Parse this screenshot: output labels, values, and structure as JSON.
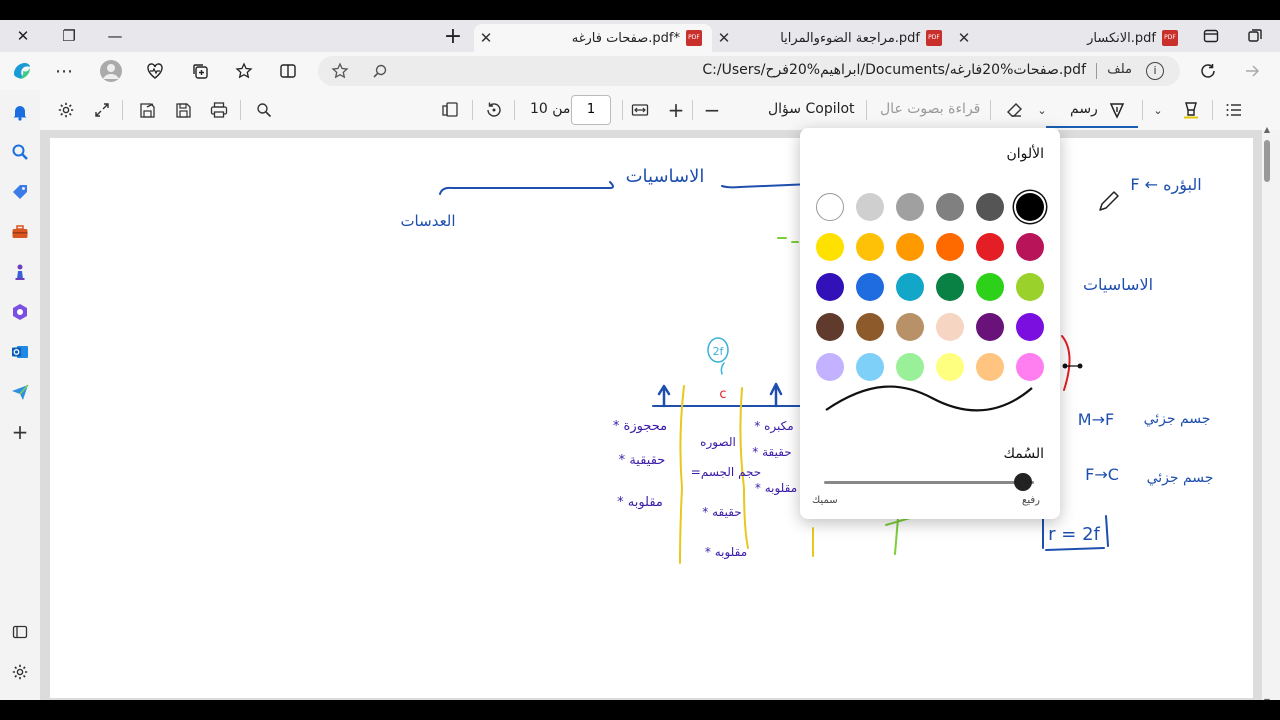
{
  "tabs": [
    {
      "title": "صفحات فارغه.pdf*",
      "active": true
    },
    {
      "title": "مراجعة الضوءوالمرايا.pdf",
      "active": false
    },
    {
      "title": "الانكسار.pdf",
      "active": false
    }
  ],
  "address": {
    "url": "C:/Users/ابراهيم%20فرح/Documents/صفحات%20فارغه.pdf",
    "file_label": "ملف"
  },
  "toolbar": {
    "draw_label": "رسم",
    "read_aloud_label": "قراءة بصوت عال",
    "copilot_label": "سؤال Copilot",
    "page_current": "1",
    "page_of_label": "من 10",
    "plus": "+",
    "minus": "−"
  },
  "color_panel": {
    "title": "الألوان",
    "colors": [
      "#000000",
      "#555555",
      "#808080",
      "#a0a0a0",
      "#cfcfcf",
      "#ffffff",
      "#b8145a",
      "#e31e24",
      "#ff6a00",
      "#ff9900",
      "#ffc107",
      "#ffe100",
      "#9ad12a",
      "#2ed11a",
      "#098044",
      "#12a7c9",
      "#1f6be0",
      "#3212b8",
      "#7a0fe0",
      "#69127a",
      "#f6d5c2",
      "#b99168",
      "#8c5a2b",
      "#603a2c",
      "#ff7ff0",
      "#ffc47f",
      "#ffff7f",
      "#99f099",
      "#7fd0f8",
      "#c2b2ff"
    ],
    "selected_color": "#000000",
    "thickness_label": "السُمك",
    "thin_label": "رفيع",
    "thick_label": "سميك"
  },
  "page_ink": {
    "text_labels": [
      {
        "text": "الاساسيات"
      },
      {
        "text": "العدسات"
      },
      {
        "text": "F ← البؤره"
      },
      {
        "text": "الاساسيات"
      },
      {
        "text": "M→F"
      },
      {
        "text": "جسم جزئي"
      },
      {
        "text": "F→C"
      },
      {
        "text": "جسم جزئي"
      },
      {
        "text": "r = 2f"
      },
      {
        "text": "2f"
      },
      {
        "text": "c"
      },
      {
        "text": "* محجوزة"
      },
      {
        "text": "* حقيقية"
      },
      {
        "text": "* مقلوبه"
      },
      {
        "text": "الصوره"
      },
      {
        "text": "=حجم الجسم"
      },
      {
        "text": "* حقيقه"
      },
      {
        "text": "* مقلوبه"
      },
      {
        "text": "* مكبره"
      },
      {
        "text": "* حقيقة"
      },
      {
        "text": "* مقلوبه"
      }
    ]
  }
}
